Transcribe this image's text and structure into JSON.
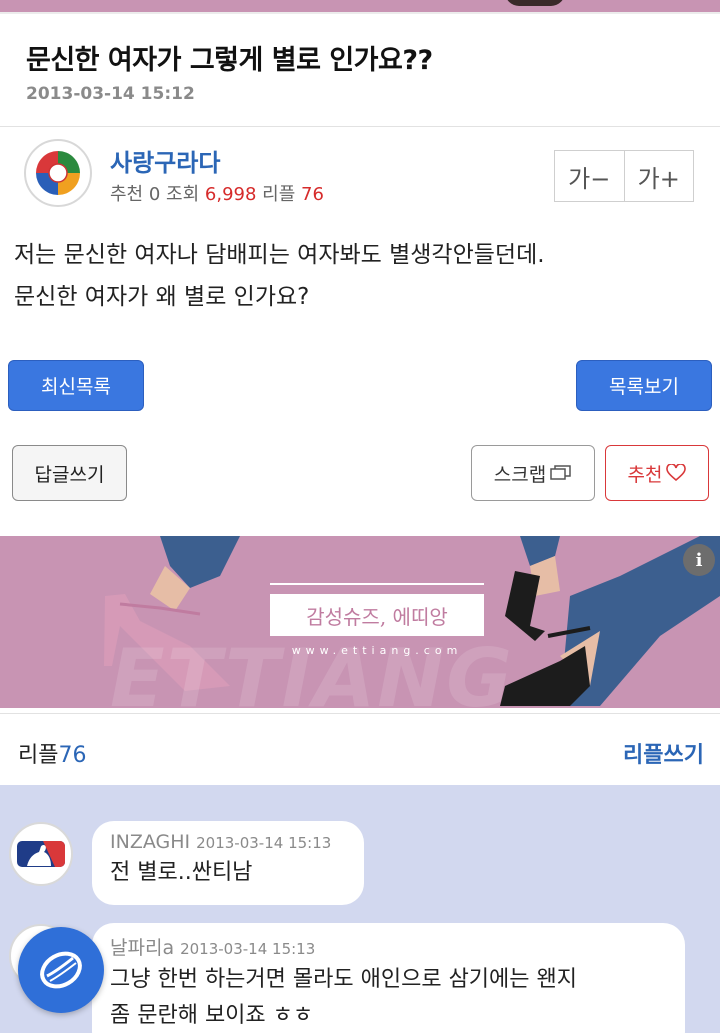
{
  "post": {
    "title": "문신한 여자가 그렇게 별로 인가요??",
    "date": "2013-03-14 15:12",
    "body_lines": [
      "저는 문신한 여자나 담배피는 여자봐도 별생각안들던데.",
      "문신한 여자가 왜 별로 인가요?"
    ]
  },
  "author": {
    "name": "사랑구라다",
    "recommend_label": "추천",
    "recommend_count": "0",
    "views_label": "조회",
    "views_count": "6,998",
    "replies_label": "리플",
    "replies_count": "76"
  },
  "font_controls": {
    "decrease": "가−",
    "increase": "가+"
  },
  "buttons": {
    "latest_list": "최신목록",
    "view_list": "목록보기",
    "write_answer": "답글쓰기",
    "scrap": "스크랩",
    "recommend": "추천"
  },
  "ad": {
    "brand_text": "감성슈즈, 에띠앙",
    "url": "www.ettiang.com",
    "watermark": "ETTIANG",
    "info_glyph": "i"
  },
  "replies": {
    "label": "리플",
    "count": "76",
    "write_label": "리플쓰기"
  },
  "comments": [
    {
      "author": "INZAGHI",
      "date": "2013-03-14 15:13",
      "lines": [
        "전 별로..싼티남"
      ]
    },
    {
      "author": "날파리a",
      "date": "2013-03-14 15:13",
      "lines": [
        "그냥 한번 하는거면 몰라도 애인으로 삼기에는 왠지",
        "좀 문란해 보이죠 ㅎㅎ"
      ]
    }
  ],
  "colors": {
    "accent_blue": "#2b66b6",
    "button_blue": "#3a77e0",
    "red": "#d9383a",
    "ad_pink": "#c894b3",
    "comment_bg": "#d2d8ef"
  },
  "icons": {
    "scrap": "copy-icon",
    "recommend": "heart-icon",
    "author_avatar": "baseball-classic-logo",
    "comment1_avatar": "mlb-logo",
    "comment2_avatar": "baseball-ball-logo",
    "floating_button": "baseball-ball-icon"
  }
}
